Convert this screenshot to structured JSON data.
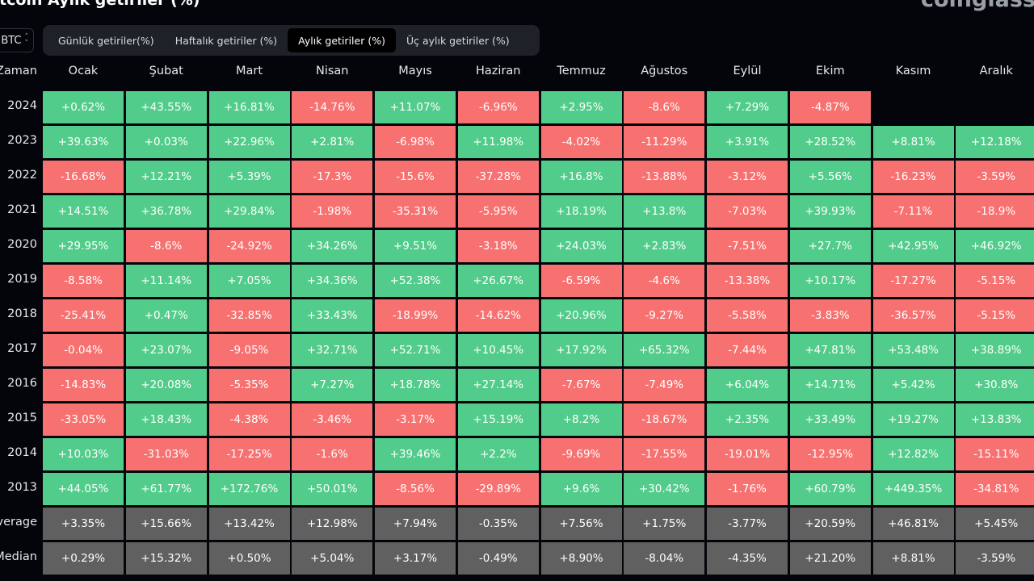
{
  "header": {
    "title": "Bitcoin Aylık getiriler (%)",
    "logo": "coinglass"
  },
  "symbol_select": {
    "value": "BTC",
    "icon": "chevron-up-down-icon"
  },
  "tabs": [
    {
      "label": "Günlük getiriler(%)",
      "active": false
    },
    {
      "label": "Haftalık getiriler (%)",
      "active": false
    },
    {
      "label": "Aylık getiriler (%)",
      "active": true
    },
    {
      "label": "Üç aylık getiriler (%)",
      "active": false
    }
  ],
  "colors": {
    "positive": "#52cc8a",
    "negative": "#f87171",
    "summary": "#606060",
    "background": "#03050a"
  },
  "table": {
    "corner_label": "Zaman",
    "months": [
      "Ocak",
      "Şubat",
      "Mart",
      "Nisan",
      "Mayıs",
      "Haziran",
      "Temmuz",
      "Ağustos",
      "Eylül",
      "Ekim",
      "Kasım",
      "Aralık"
    ],
    "rows": [
      {
        "label": "2024",
        "values": [
          "+0.62%",
          "+43.55%",
          "+16.81%",
          "-14.76%",
          "+11.07%",
          "-6.96%",
          "+2.95%",
          "-8.6%",
          "+7.29%",
          "-4.87%",
          "",
          ""
        ]
      },
      {
        "label": "2023",
        "values": [
          "+39.63%",
          "+0.03%",
          "+22.96%",
          "+2.81%",
          "-6.98%",
          "+11.98%",
          "-4.02%",
          "-11.29%",
          "+3.91%",
          "+28.52%",
          "+8.81%",
          "+12.18%"
        ]
      },
      {
        "label": "2022",
        "values": [
          "-16.68%",
          "+12.21%",
          "+5.39%",
          "-17.3%",
          "-15.6%",
          "-37.28%",
          "+16.8%",
          "-13.88%",
          "-3.12%",
          "+5.56%",
          "-16.23%",
          "-3.59%"
        ]
      },
      {
        "label": "2021",
        "values": [
          "+14.51%",
          "+36.78%",
          "+29.84%",
          "-1.98%",
          "-35.31%",
          "-5.95%",
          "+18.19%",
          "+13.8%",
          "-7.03%",
          "+39.93%",
          "-7.11%",
          "-18.9%"
        ]
      },
      {
        "label": "2020",
        "values": [
          "+29.95%",
          "-8.6%",
          "-24.92%",
          "+34.26%",
          "+9.51%",
          "-3.18%",
          "+24.03%",
          "+2.83%",
          "-7.51%",
          "+27.7%",
          "+42.95%",
          "+46.92%"
        ]
      },
      {
        "label": "2019",
        "values": [
          "-8.58%",
          "+11.14%",
          "+7.05%",
          "+34.36%",
          "+52.38%",
          "+26.67%",
          "-6.59%",
          "-4.6%",
          "-13.38%",
          "+10.17%",
          "-17.27%",
          "-5.15%"
        ]
      },
      {
        "label": "2018",
        "values": [
          "-25.41%",
          "+0.47%",
          "-32.85%",
          "+33.43%",
          "-18.99%",
          "-14.62%",
          "+20.96%",
          "-9.27%",
          "-5.58%",
          "-3.83%",
          "-36.57%",
          "-5.15%"
        ]
      },
      {
        "label": "2017",
        "values": [
          "-0.04%",
          "+23.07%",
          "-9.05%",
          "+32.71%",
          "+52.71%",
          "+10.45%",
          "+17.92%",
          "+65.32%",
          "-7.44%",
          "+47.81%",
          "+53.48%",
          "+38.89%"
        ]
      },
      {
        "label": "2016",
        "values": [
          "-14.83%",
          "+20.08%",
          "-5.35%",
          "+7.27%",
          "+18.78%",
          "+27.14%",
          "-7.67%",
          "-7.49%",
          "+6.04%",
          "+14.71%",
          "+5.42%",
          "+30.8%"
        ]
      },
      {
        "label": "2015",
        "values": [
          "-33.05%",
          "+18.43%",
          "-4.38%",
          "-3.46%",
          "-3.17%",
          "+15.19%",
          "+8.2%",
          "-18.67%",
          "+2.35%",
          "+33.49%",
          "+19.27%",
          "+13.83%"
        ]
      },
      {
        "label": "2014",
        "values": [
          "+10.03%",
          "-31.03%",
          "-17.25%",
          "-1.6%",
          "+39.46%",
          "+2.2%",
          "-9.69%",
          "-17.55%",
          "-19.01%",
          "-12.95%",
          "+12.82%",
          "-15.11%"
        ]
      },
      {
        "label": "2013",
        "values": [
          "+44.05%",
          "+61.77%",
          "+172.76%",
          "+50.01%",
          "-8.56%",
          "-29.89%",
          "+9.6%",
          "+30.42%",
          "-1.76%",
          "+60.79%",
          "+449.35%",
          "-34.81%"
        ]
      },
      {
        "label": "Average",
        "summary": true,
        "values": [
          "+3.35%",
          "+15.66%",
          "+13.42%",
          "+12.98%",
          "+7.94%",
          "-0.35%",
          "+7.56%",
          "+1.75%",
          "-3.77%",
          "+20.59%",
          "+46.81%",
          "+5.45%"
        ]
      },
      {
        "label": "Median",
        "summary": true,
        "values": [
          "+0.29%",
          "+15.32%",
          "+0.50%",
          "+5.04%",
          "+3.17%",
          "-0.49%",
          "+8.90%",
          "-8.04%",
          "-4.35%",
          "+21.20%",
          "+8.81%",
          "-3.59%"
        ]
      }
    ]
  }
}
